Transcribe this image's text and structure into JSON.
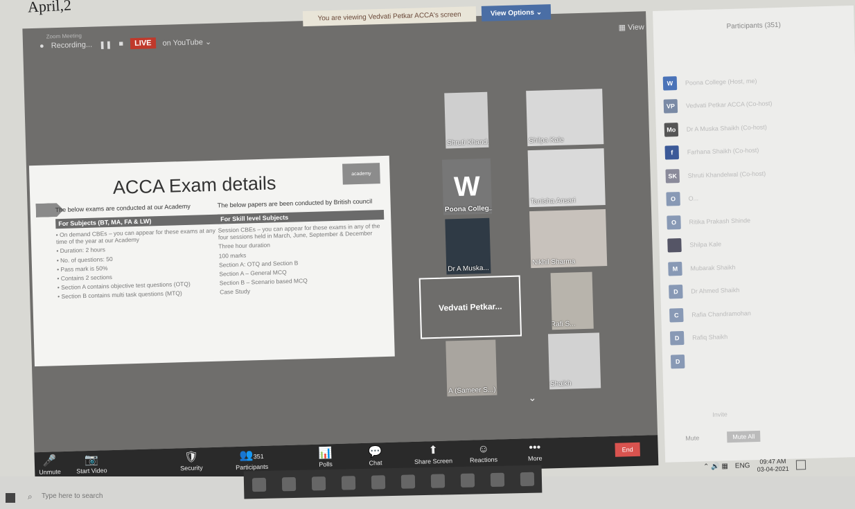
{
  "page_corner_text": "April,2",
  "window": {
    "minimize_icon": "minimize-icon",
    "maximize_icon": "maximize-icon",
    "close_icon": "close-icon",
    "minimize": "–",
    "maximize": "□",
    "close": "×"
  },
  "share": {
    "banner": "You are viewing Vedvati Petkar ACCA's screen",
    "view_options": "View Options ⌄"
  },
  "recording": {
    "meeting_label": "Zoom Meeting",
    "label": "Recording...",
    "live": "LIVE",
    "youtube": "on YouTube ⌄",
    "view": "▦ View"
  },
  "slide": {
    "title": "ACCA Exam details",
    "logo": "academy",
    "left": {
      "intro": "The below exams are conducted at our Academy",
      "bar": "For Subjects (BT, MA, FA & LW)",
      "lines": [
        "• On demand CBEs – you can appear for these exams at any time of the year at our Academy",
        "• Duration: 2 hours",
        "• No. of questions: 50",
        "• Pass mark is 50%",
        "• Contains 2 sections",
        "• Section A contains objective test questions (OTQ)",
        "• Section B contains multi task questions (MTQ)"
      ]
    },
    "right": {
      "intro": "The below papers are been conducted by British council",
      "bar": "For Skill level Subjects",
      "lines": [
        "Session CBEs – you can appear for these exams in any of the four sessions held in March, June, September & December",
        "Three hour duration",
        "100 marks",
        "Section A: OTQ and Section B",
        "Section A – General MCQ",
        "Section B – Scenario based MCQ",
        "Case Study"
      ]
    }
  },
  "participants_tiles": [
    {
      "name": "Shruti Khand...",
      "letter": ""
    },
    {
      "name": "Shilpa Kale",
      "letter": ""
    },
    {
      "name": "Poona Colleg...",
      "letter": "W"
    },
    {
      "name": "Tanisha Ansari",
      "letter": ""
    },
    {
      "name": "Dr A Muska...",
      "letter": ""
    },
    {
      "name": "Nikhil Sharma",
      "letter": ""
    },
    {
      "name": "Vedvati Petkar...",
      "letter": ""
    },
    {
      "name": "Abdul Rafi S...",
      "letter": ""
    },
    {
      "name": "A (Sameer S...)",
      "letter": ""
    },
    {
      "name": "Afzal Shaikh",
      "letter": ""
    }
  ],
  "toolbar": {
    "unmute": "Unmute",
    "start_video": "Start Video",
    "security": "Security",
    "participants": "Participants",
    "participants_count": "351",
    "polls": "Polls",
    "chat": "Chat",
    "share_screen": "Share Screen",
    "reactions": "Reactions",
    "more": "More",
    "end": "End",
    "icons": {
      "mic": "🎤",
      "video": "📷",
      "security": "🛡",
      "participants": "👥",
      "polls": "📊",
      "chat": "💬",
      "share": "⬆",
      "reactions": "☺",
      "more": "•••",
      "chevron": "⌄"
    }
  },
  "panel": {
    "title": "Participants (351)",
    "rows": [
      {
        "avatar": "W",
        "name": "Poona College (Host, me)",
        "color": "#4a73b8"
      },
      {
        "avatar": "VP",
        "name": "Vedvati Petkar ACCA (Co-host)",
        "color": "#7a8aa5"
      },
      {
        "avatar": "Mo",
        "name": "Dr A Muska Shaikh (Co-host)",
        "color": "#555"
      },
      {
        "avatar": "f",
        "name": "Farhana Shaikh (Co-host)",
        "color": "#3b5998"
      },
      {
        "avatar": "SK",
        "name": "Shruti Khandelwal (Co-host)",
        "color": "#8a8a9a"
      },
      {
        "avatar": "O",
        "name": "O...",
        "color": "#8899b5"
      },
      {
        "avatar": "O",
        "name": "Ritika Prakash Shinde",
        "color": "#8899b5"
      },
      {
        "avatar": "",
        "name": "Shilpa Kale",
        "color": "#556"
      },
      {
        "avatar": "M",
        "name": "Mubarak Shaikh",
        "color": "#8899b5"
      },
      {
        "avatar": "D",
        "name": "Dr Ahmed Shaikh",
        "color": "#8899b5"
      },
      {
        "avatar": "C",
        "name": "Rafia Chandramohan",
        "color": "#8899b5"
      },
      {
        "avatar": "D",
        "name": "Rafiq Shaikh",
        "color": "#8899b5"
      },
      {
        "avatar": "D",
        "name": "",
        "color": "#8899b5"
      }
    ],
    "invite": "Invite",
    "mute_label": "Mute",
    "mute_all": "Mute All"
  },
  "taskbar": {
    "search_placeholder": "Type here to search",
    "search_icon": "⌕",
    "lang": "ENG",
    "time": "09:47 AM",
    "date": "03-04-2021",
    "tray_icons": "⌃ 🔊 ▦"
  }
}
